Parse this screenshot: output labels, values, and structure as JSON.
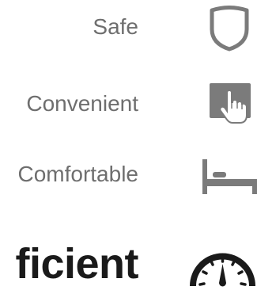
{
  "features": [
    {
      "label": "Safe",
      "icon": "shield-icon"
    },
    {
      "label": "Convenient",
      "icon": "touch-tap-icon"
    },
    {
      "label": "Comfortable",
      "icon": "bed-icon"
    },
    {
      "label": "ficient",
      "icon": "speedometer-icon"
    }
  ],
  "colors": {
    "label": "#6e6e6e",
    "icon": "#7b7b7b",
    "heading": "#1a1a1a"
  }
}
